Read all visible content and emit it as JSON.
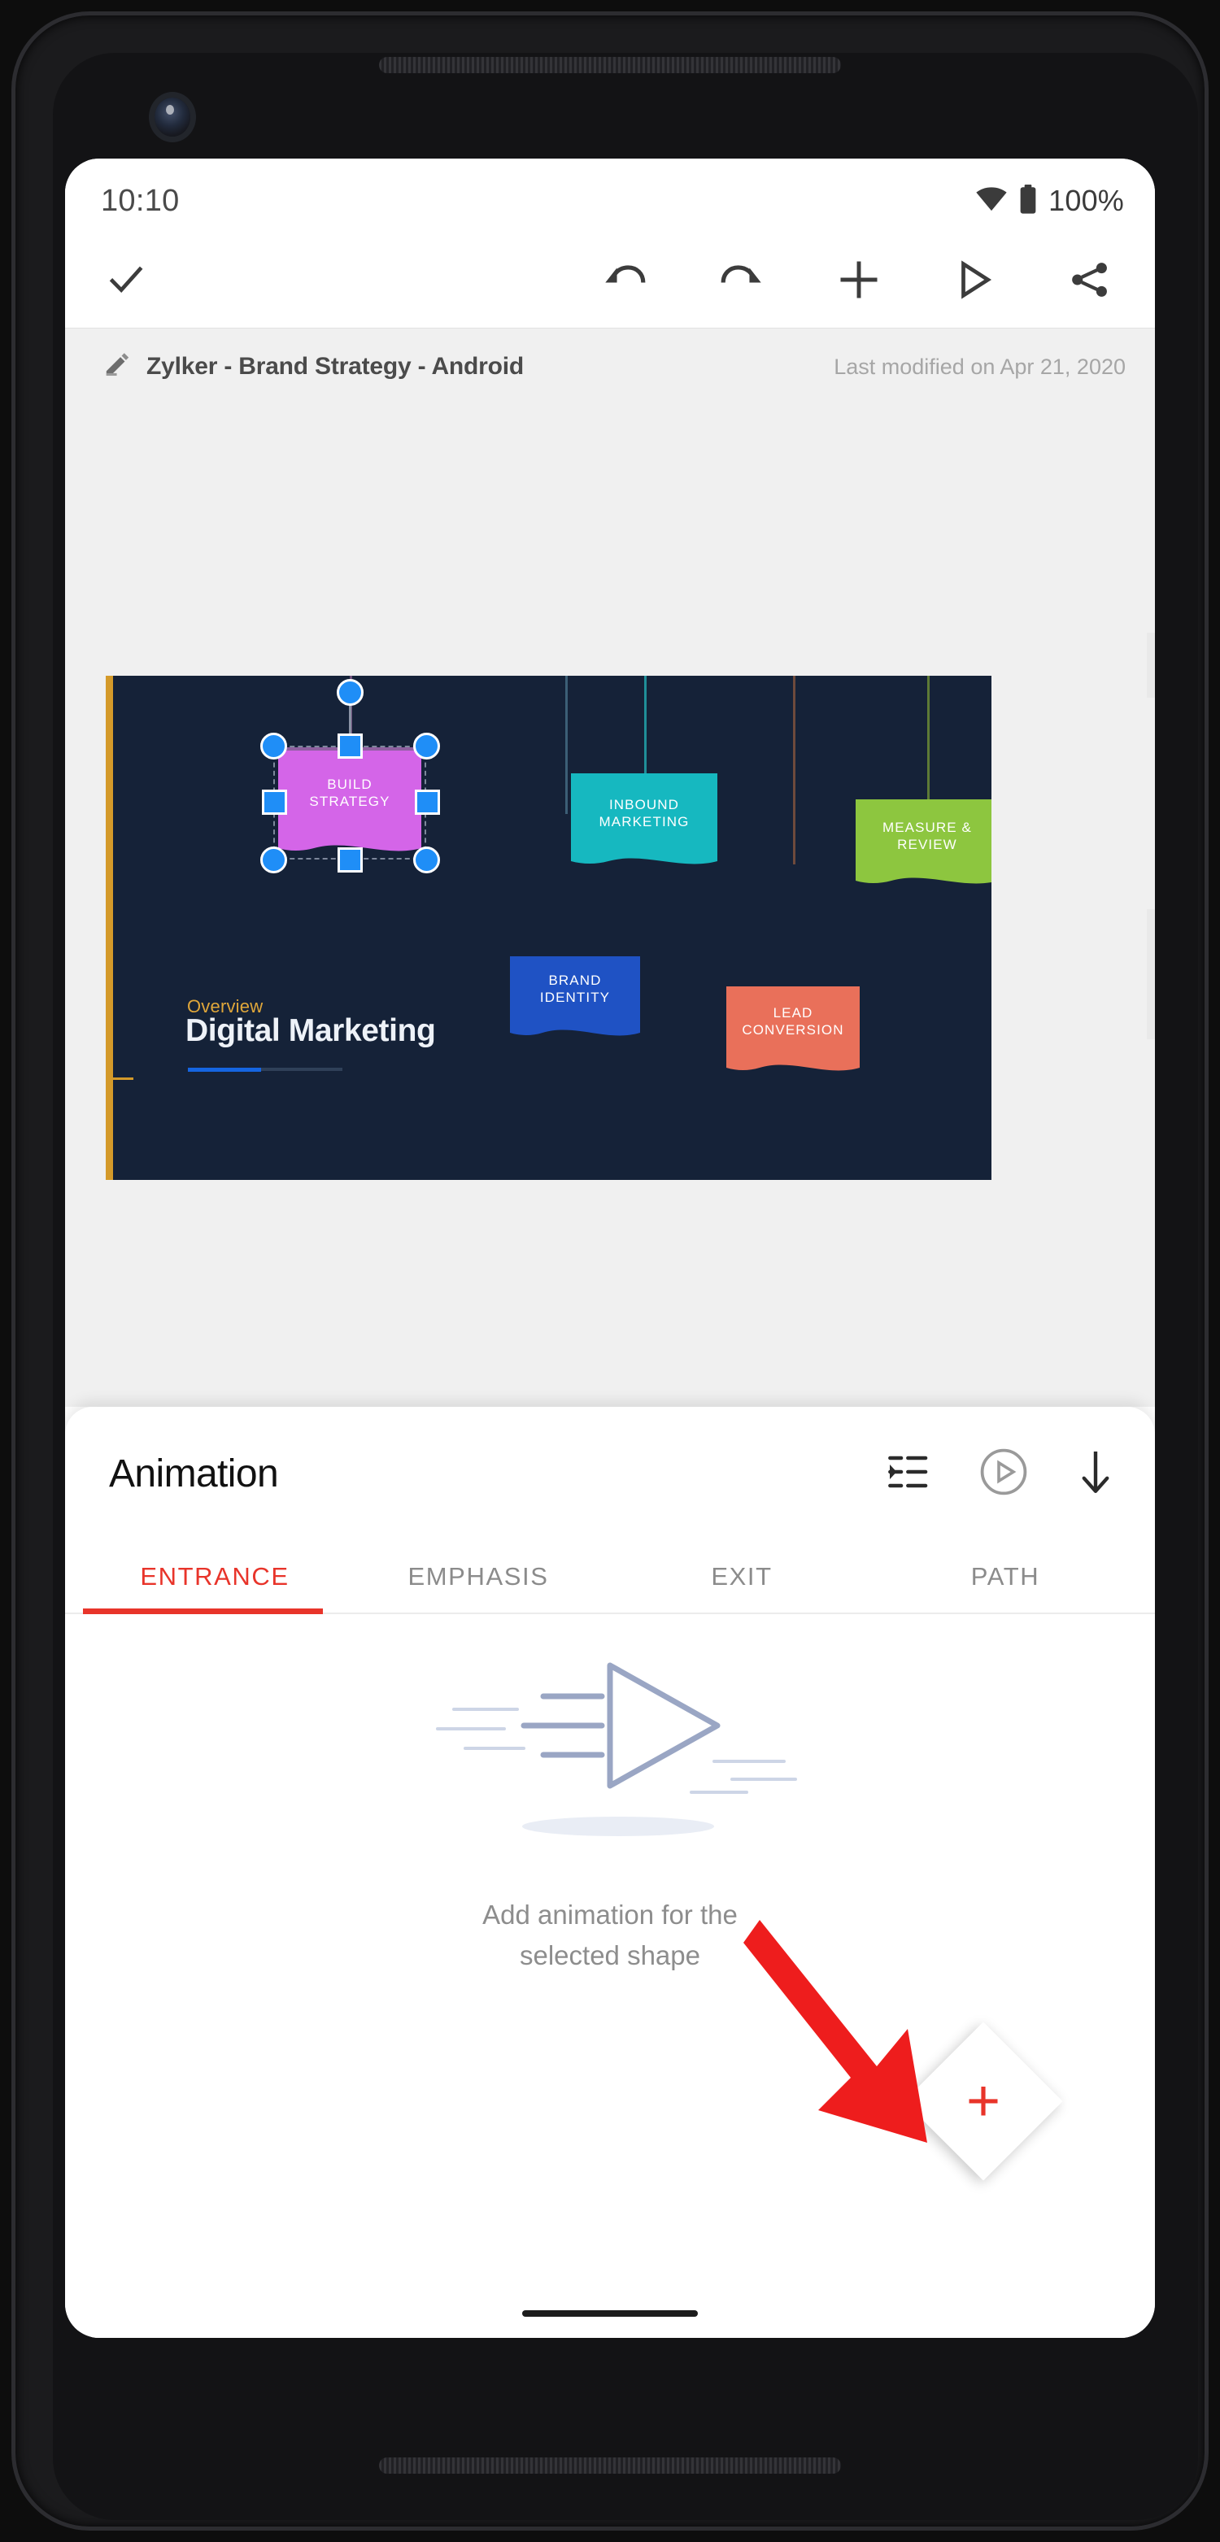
{
  "status_bar": {
    "time": "10:10",
    "battery_percent": "100%",
    "wifi_icon": "wifi-icon",
    "battery_icon": "battery-full-icon"
  },
  "toolbar": {
    "done_icon": "checkmark-icon",
    "undo_icon": "undo-icon",
    "redo_icon": "redo-icon",
    "add_icon": "plus-icon",
    "present_icon": "play-icon",
    "share_icon": "share-icon"
  },
  "document": {
    "edit_icon": "pencil-icon",
    "title": "Zylker - Brand Strategy - Android",
    "last_modified": "Last modified on Apr 21, 2020"
  },
  "slide": {
    "background_color": "#152238",
    "accent_color": "#d49a2a",
    "eyebrow": "Overview",
    "title": "Digital Marketing",
    "shapes": [
      {
        "label": "BUILD STRATEGY",
        "color": "#d465e8",
        "selected": true
      },
      {
        "label": "INBOUND MARKETING",
        "color": "#16b8c0",
        "selected": false
      },
      {
        "label": "MEASURE & REVIEW",
        "color": "#8dc63f",
        "selected": false
      },
      {
        "label": "BRAND IDENTITY",
        "color": "#1f52c4",
        "selected": false
      },
      {
        "label": "LEAD CONVERSION",
        "color": "#e9705a",
        "selected": false
      }
    ]
  },
  "animation_panel": {
    "title": "Animation",
    "reorder_icon": "list-reorder-icon",
    "preview_icon": "play-circle-icon",
    "collapse_icon": "arrow-down-icon",
    "tabs": [
      {
        "label": "ENTRANCE",
        "active": true
      },
      {
        "label": "EMPHASIS",
        "active": false
      },
      {
        "label": "EXIT",
        "active": false
      },
      {
        "label": "PATH",
        "active": false
      }
    ],
    "active_tab_color": "#e8342a",
    "empty_state_line1": "Add animation for the",
    "empty_state_line2": "selected shape",
    "empty_state_icon": "animation-play-illustration",
    "fab_icon": "plus-icon",
    "fab_accent_color": "#e8342a"
  },
  "annotation": {
    "arrow_color": "#ee1d1d",
    "arrow_icon": "red-arrow-pointer"
  }
}
